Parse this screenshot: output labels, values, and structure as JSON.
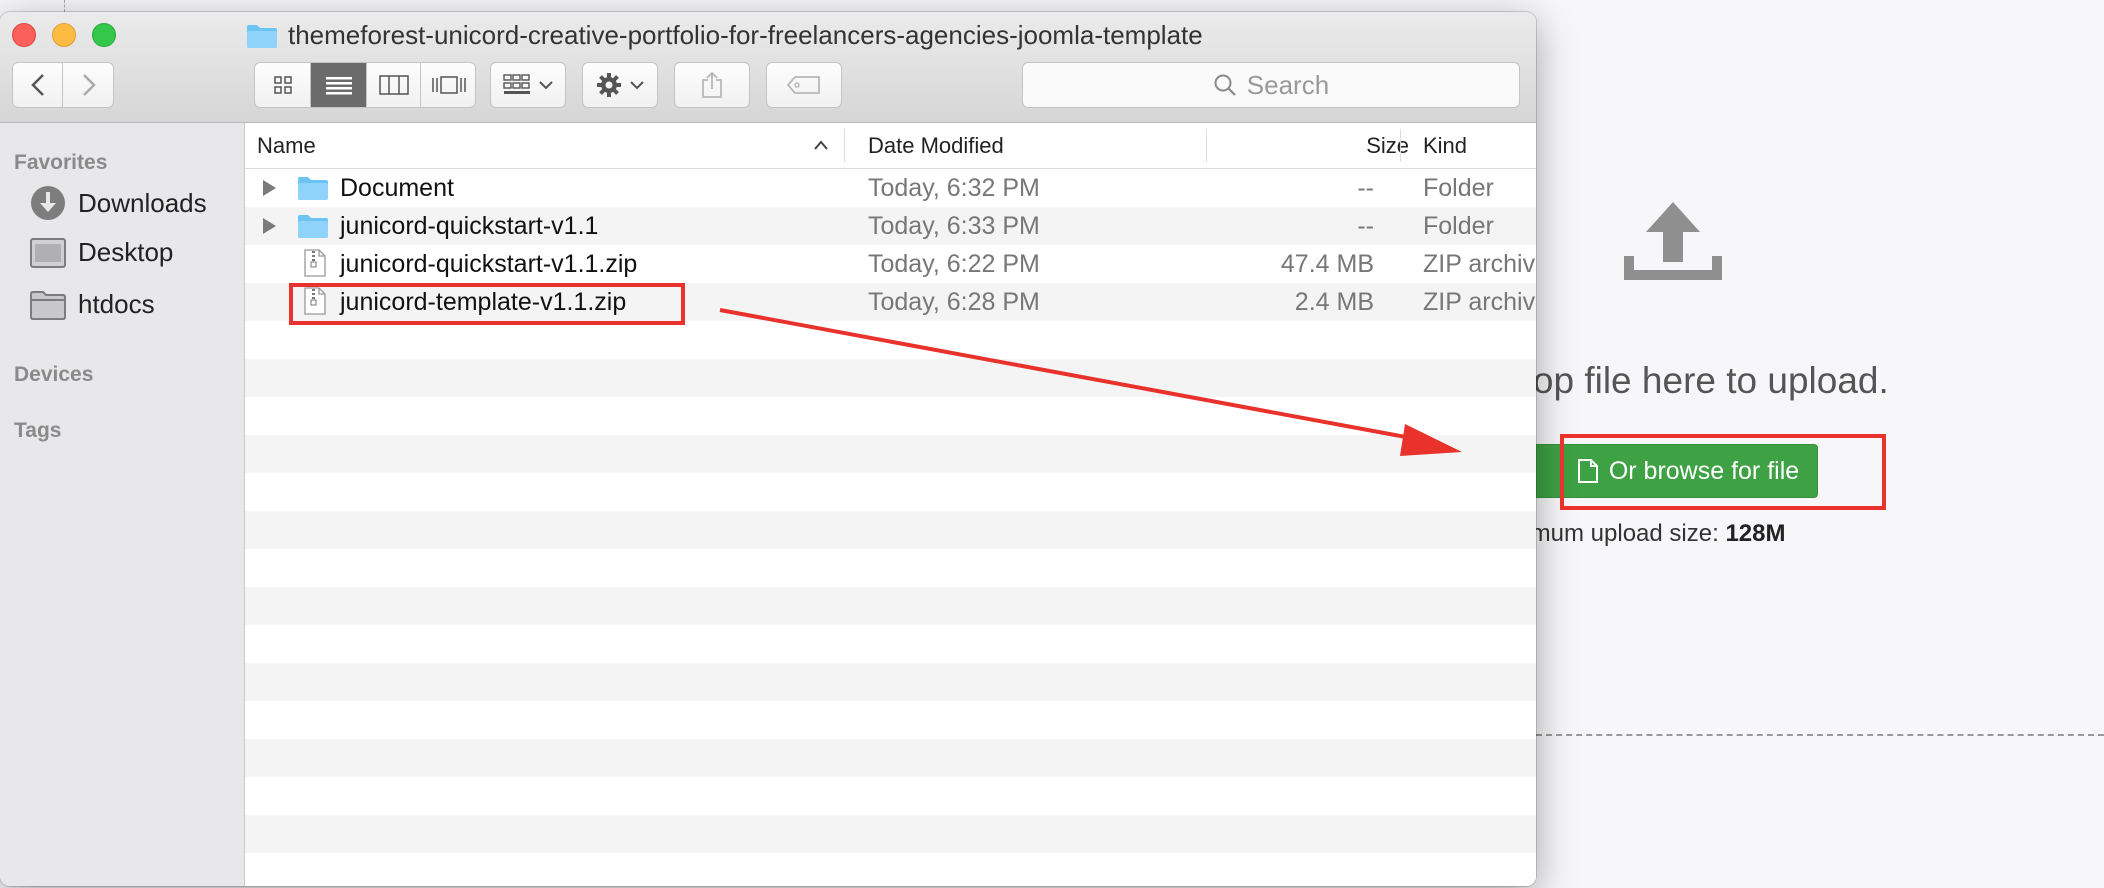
{
  "upload": {
    "drop_text": "drop file here to upload.",
    "browse_label": "Or browse for file",
    "max_size_label": "aximum upload size:",
    "max_size_value": "128M"
  },
  "finder": {
    "title": "themeforest-unicord-creative-portfolio-for-freelancers-agencies-joomla-template",
    "search_placeholder": "Search",
    "sidebar": {
      "favorites_heading": "Favorites",
      "favorites": [
        {
          "label": "Downloads",
          "icon": "downloads-icon"
        },
        {
          "label": "Desktop",
          "icon": "desktop-icon"
        },
        {
          "label": "htdocs",
          "icon": "folder-icon"
        }
      ],
      "devices_heading": "Devices",
      "tags_heading": "Tags"
    },
    "columns": {
      "name": "Name",
      "date": "Date Modified",
      "size": "Size",
      "kind": "Kind"
    },
    "files": [
      {
        "name": "Document",
        "date": "Today, 6:32 PM",
        "size": "--",
        "kind": "Folder",
        "type": "folder"
      },
      {
        "name": "junicord-quickstart-v1.1",
        "date": "Today, 6:33 PM",
        "size": "--",
        "kind": "Folder",
        "type": "folder"
      },
      {
        "name": "junicord-quickstart-v1.1.zip",
        "date": "Today, 6:22 PM",
        "size": "47.4 MB",
        "kind": "ZIP archive",
        "type": "zip"
      },
      {
        "name": "junicord-template-v1.1.zip",
        "date": "Today, 6:28 PM",
        "size": "2.4 MB",
        "kind": "ZIP archive",
        "type": "zip"
      }
    ]
  },
  "colors": {
    "annotation": "#e8322b",
    "browse_button": "#3ea144",
    "folder": "#6cc4f5"
  }
}
